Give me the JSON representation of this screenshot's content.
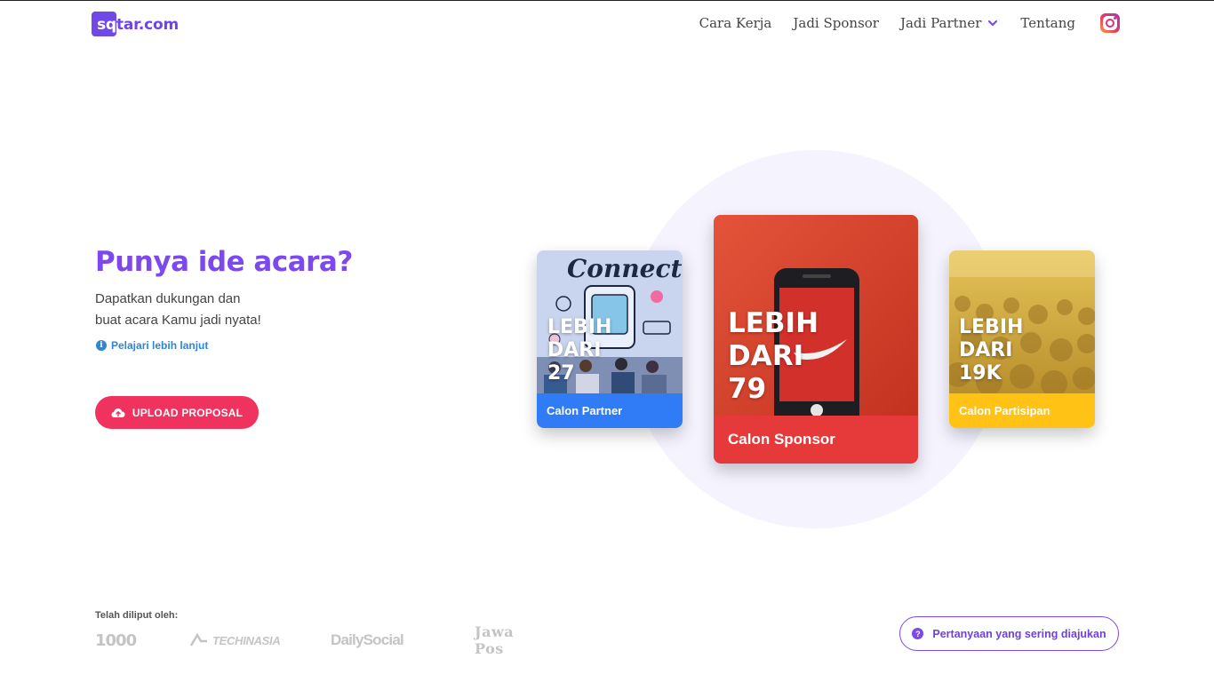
{
  "brand": {
    "logo_text_part1": "sq",
    "logo_text_part2": "tar.com",
    "accent": "#7d49ee"
  },
  "nav": {
    "items": [
      {
        "label": "Cara Kerja"
      },
      {
        "label": "Jadi Sponsor"
      },
      {
        "label": "Jadi Partner",
        "icon": "chevron-down-icon"
      },
      {
        "label": "Tentang"
      }
    ],
    "social_icon": "instagram-icon"
  },
  "hero": {
    "title": "Punya ide acara?",
    "subtitle_line1": "Dapatkan dukungan dan",
    "subtitle_line2": "buat acara Kamu jadi nyata!",
    "learn_more": "Pelajari lebih lanjut",
    "upload_button": "UPLOAD PROPOSAL"
  },
  "cards": {
    "partner": {
      "line1": "LEBIH",
      "line2": "DARI",
      "value": "27",
      "label": "Calon Partner",
      "color": "#2f7cf6",
      "image_text": "Connect"
    },
    "sponsor": {
      "line1": "LEBIH",
      "line2": "DARI",
      "value": "79",
      "label": "Calon Sponsor",
      "color": "#e63a3a"
    },
    "partisipan": {
      "line1": "LEBIH",
      "line2": "DARI",
      "value": "19K",
      "label": "Calon Partisipan",
      "color": "#ffc215"
    }
  },
  "footer": {
    "covered_label": "Telah diliput oleh:",
    "press": [
      "1000",
      "TECHINASIA",
      "DailySocial",
      "Jawa Pos"
    ],
    "faq_button": "Pertanyaan yang sering diajukan"
  }
}
